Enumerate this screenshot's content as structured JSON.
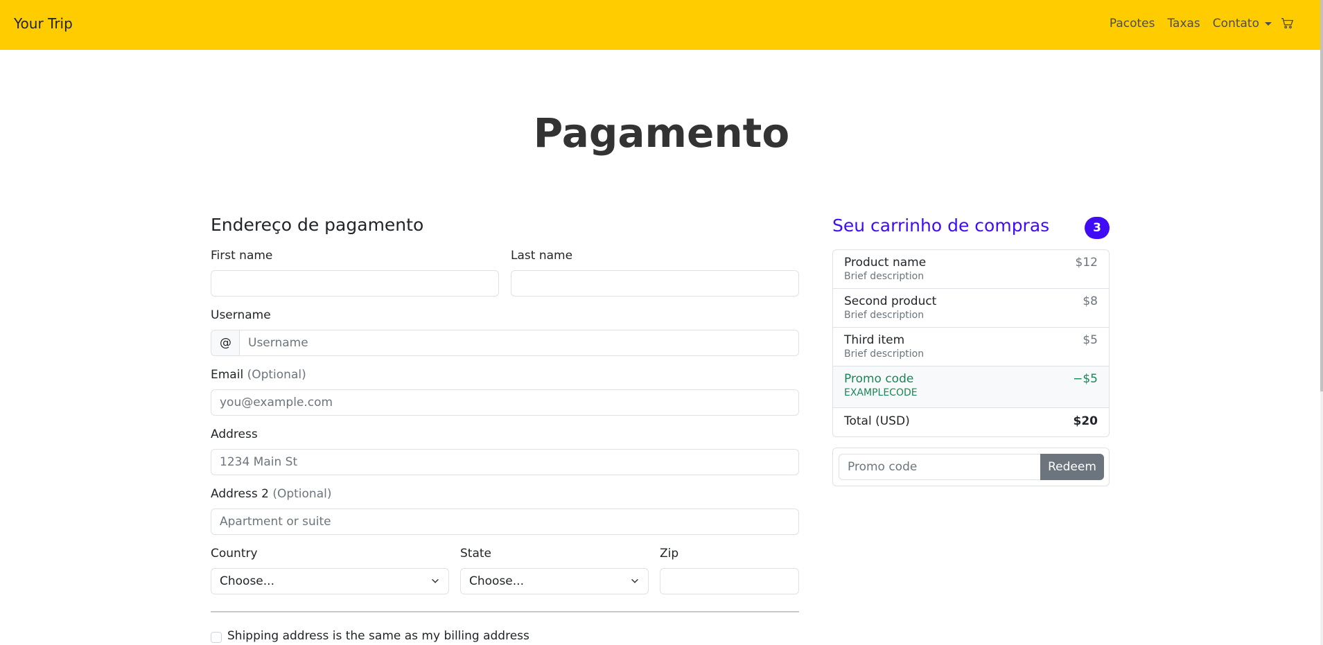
{
  "navbar": {
    "brand": "Your Trip",
    "links": [
      "Pacotes",
      "Taxas",
      "Contato"
    ],
    "cart_icon": "cart-icon",
    "color": "#ffcc00"
  },
  "page": {
    "title": "Pagamento"
  },
  "form": {
    "section_title": "Endereço de pagamento",
    "first_name_label": "First name",
    "last_name_label": "Last name",
    "username_label": "Username",
    "username_prefix": "@",
    "username_placeholder": "Username",
    "email_label": "Email",
    "optional": "(Optional)",
    "email_placeholder": "you@example.com",
    "address_label": "Address",
    "address_placeholder": "1234 Main St",
    "address2_label": "Address 2",
    "address2_placeholder": "Apartment or suite",
    "country_label": "Country",
    "country_value": "Choose...",
    "state_label": "State",
    "state_value": "Choose...",
    "zip_label": "Zip",
    "same_address_label": "Shipping address is the same as my billing address"
  },
  "cart": {
    "title": "Seu carrinho de compras",
    "count": "3",
    "accent": "#3f0cf5",
    "items": [
      {
        "name": "Product name",
        "desc": "Brief description",
        "price": "$12"
      },
      {
        "name": "Second product",
        "desc": "Brief description",
        "price": "$8"
      },
      {
        "name": "Third item",
        "desc": "Brief description",
        "price": "$5"
      }
    ],
    "promo": {
      "name": "Promo code",
      "code": "EXAMPLECODE",
      "amount": "−$5"
    },
    "total_label": "Total (USD)",
    "total_value": "$20",
    "promo_placeholder": "Promo code",
    "redeem_label": "Redeem"
  }
}
